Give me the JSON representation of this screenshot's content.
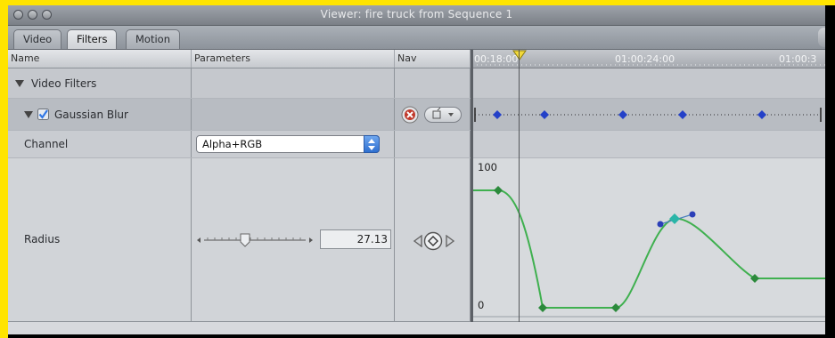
{
  "window": {
    "title": "Viewer: fire truck from Sequence 1"
  },
  "tabs": [
    {
      "label": "Video",
      "active": false
    },
    {
      "label": "Filters",
      "active": true
    },
    {
      "label": "Motion",
      "active": false
    }
  ],
  "columns": {
    "name": "Name",
    "parameters": "Parameters",
    "nav": "Nav"
  },
  "timeline": {
    "ticks": [
      "00:18:00",
      "01:00:24:00",
      "01:00:3"
    ],
    "graph_max_label": "100",
    "graph_min_label": "0"
  },
  "rows": {
    "video_filters": {
      "label": "Video Filters"
    },
    "gaussian_blur": {
      "label": "Gaussian Blur",
      "enabled": true
    },
    "channel": {
      "label": "Channel",
      "value": "Alpha+RGB"
    },
    "radius": {
      "label": "Radius",
      "value": "27.13",
      "slider_fraction": 0.4
    }
  },
  "colors": {
    "keyframe_blue": "#2441c8",
    "curve_green": "#3fb04f",
    "keyframe_green": "#2c8a3c",
    "checkbox_blue": "#3278e6"
  }
}
